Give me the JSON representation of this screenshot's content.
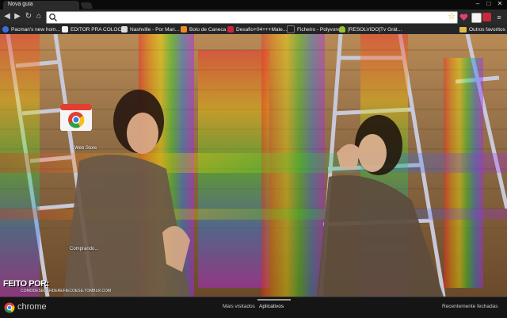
{
  "window": {
    "tab_title": "Nova guia",
    "controls": {
      "minimize": "–",
      "maximize": "□",
      "close": "✕"
    }
  },
  "toolbar": {
    "back_icon": "back-arrow-icon",
    "forward_icon": "forward-arrow-icon",
    "reload_icon": "reload-icon",
    "home_icon": "home-icon",
    "omnibox_value": "",
    "star_icon": "star-icon"
  },
  "bookmarks": [
    {
      "label": "Pacman's new hom...",
      "icon": "pacman-site-icon",
      "color": "#3b6fd8"
    },
    {
      "label": "EDITOR PRA COLOC...",
      "icon": "page-icon",
      "color": "#f2f2f2"
    },
    {
      "label": "Nashville - Por Mari...",
      "icon": "page-icon",
      "color": "#dcdcdc"
    },
    {
      "label": "Bolo de Caneca",
      "icon": "blogger-icon",
      "color": "#f08a24"
    },
    {
      "label": "Desafio+04+++Mate...",
      "icon": "site-icon",
      "color": "#c8283c"
    },
    {
      "label": "Ficheiro - Polyvore",
      "icon": "polyvore-icon",
      "color": "#222222"
    },
    {
      "label": "[RESOLVIDO]Tv Grát...",
      "icon": "android-icon",
      "color": "#9bc230"
    }
  ],
  "other_bookmarks": "Outros favoritos",
  "apps": [
    {
      "label": "Web Store"
    },
    {
      "label": "Comprando..."
    }
  ],
  "credit": {
    "title": "FEITO POR:",
    "url": "COMODESEUERDEREFIECOESE.TOMBLR.COM"
  },
  "bottom": {
    "brand": "chrome",
    "pages": [
      "Mais visitados",
      "Aplicativos"
    ],
    "active_page": "Aplicativos",
    "recent": "Recentemente fechadas"
  }
}
